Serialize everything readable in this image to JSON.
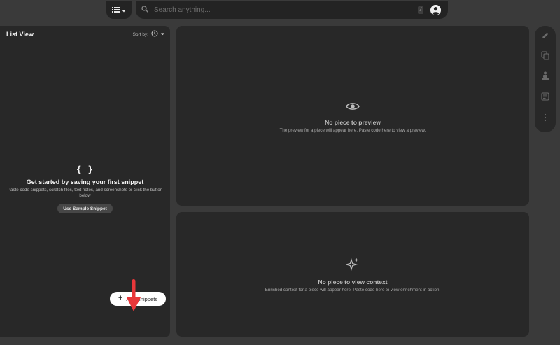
{
  "search": {
    "placeholder": "Search anything...",
    "shortcut": "/"
  },
  "list_panel": {
    "title": "List View",
    "sort_label": "Sort by:"
  },
  "empty_state": {
    "icon": "{ }",
    "title": "Get started by saving your first snippet",
    "description": "Paste code snippets, scratch files, text notes, and screenshots or click the button below",
    "button_label": "Use Sample Snippet"
  },
  "add_button": {
    "icon": "+",
    "label": "Add Snippets"
  },
  "preview": {
    "title": "No piece to preview",
    "description": "The preview for a piece will appear here. Paste code here to view a preview."
  },
  "context": {
    "title": "No piece to view context",
    "description": "Enriched context for a piece will appear here. Paste code here to view enrichment in action."
  },
  "toolbar_icons": [
    "edit-icon",
    "copy-icon",
    "share-icon",
    "notes-icon",
    "more-icon"
  ],
  "colors": {
    "background": "#3a3a3a",
    "panel": "#282828",
    "annotation_arrow": "#e8373a",
    "primary_button": "#ffffff"
  }
}
